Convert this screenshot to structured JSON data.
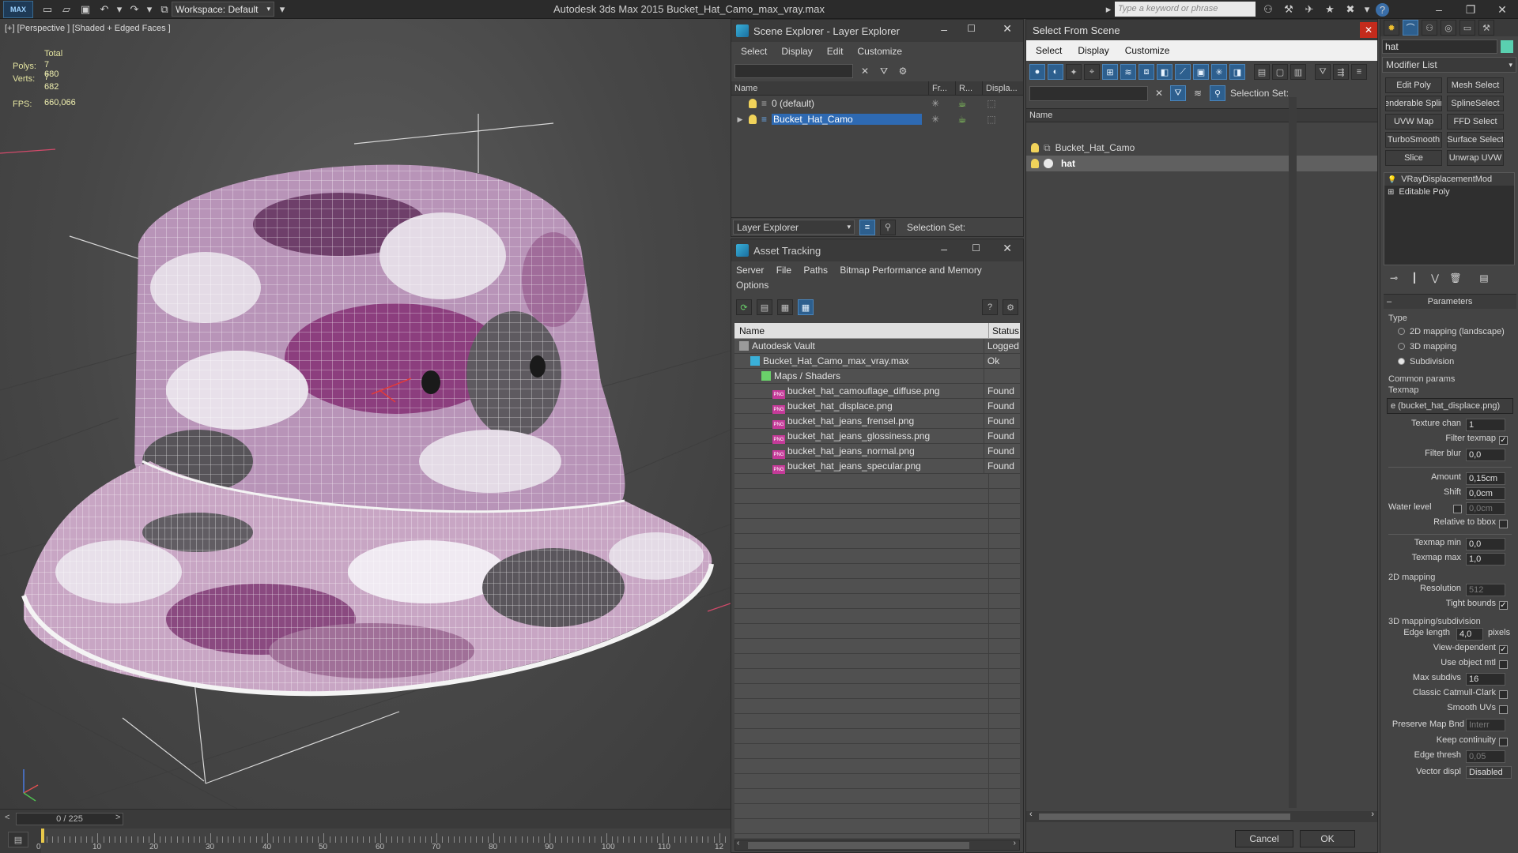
{
  "titlebar": {
    "logo": "MAX",
    "workspace": "Workspace: Default",
    "app_title": "Autodesk 3ds Max  2015      Bucket_Hat_Camo_max_vray.max",
    "search_placeholder": "Type a keyword or phrase"
  },
  "viewport": {
    "label": "[+] [Perspective ] [Shaded + Edged Faces ]",
    "stats": {
      "total_label": "Total",
      "polys_label": "Polys:",
      "polys": "7 680",
      "verts_label": "Verts:",
      "verts": "7 682",
      "fps_label": "FPS:",
      "fps": "660,066"
    }
  },
  "timeline": {
    "slider": "0 / 225",
    "ticks": [
      "0",
      "10",
      "20",
      "30",
      "40",
      "50",
      "60",
      "70",
      "80",
      "90",
      "100",
      "110",
      "12"
    ]
  },
  "scene_explorer": {
    "title": "Scene Explorer - Layer Explorer",
    "menu": [
      "Select",
      "Display",
      "Edit",
      "Customize"
    ],
    "columns": [
      "Name",
      "Fr...",
      "R...",
      "Displa..."
    ],
    "layers": [
      {
        "name": "0 (default)",
        "selected": false
      },
      {
        "name": "Bucket_Hat_Camo",
        "selected": true
      }
    ],
    "footer_dropdown": "Layer Explorer",
    "selection_set_label": "Selection Set:"
  },
  "asset_tracking": {
    "title": "Asset Tracking",
    "menu": [
      "Server",
      "File",
      "Paths",
      "Bitmap Performance and Memory",
      "Options"
    ],
    "columns": {
      "name": "Name",
      "status": "Status"
    },
    "rows": [
      {
        "name": "Autodesk Vault",
        "status": "Logged",
        "indent": 0,
        "icon": "vault-icon"
      },
      {
        "name": "Bucket_Hat_Camo_max_vray.max",
        "status": "Ok",
        "indent": 1,
        "icon": "max-file-icon"
      },
      {
        "name": "Maps / Shaders",
        "status": "",
        "indent": 2,
        "icon": "maps-folder-icon"
      },
      {
        "name": "bucket_hat_camouflage_diffuse.png",
        "status": "Found",
        "indent": 3,
        "icon": "png-icon"
      },
      {
        "name": "bucket_hat_displace.png",
        "status": "Found",
        "indent": 3,
        "icon": "png-icon"
      },
      {
        "name": "bucket_hat_jeans_frensel.png",
        "status": "Found",
        "indent": 3,
        "icon": "png-icon"
      },
      {
        "name": "bucket_hat_jeans_glossiness.png",
        "status": "Found",
        "indent": 3,
        "icon": "png-icon"
      },
      {
        "name": "bucket_hat_jeans_normal.png",
        "status": "Found",
        "indent": 3,
        "icon": "png-icon"
      },
      {
        "name": "bucket_hat_jeans_specular.png",
        "status": "Found",
        "indent": 3,
        "icon": "png-icon"
      }
    ],
    "png_badge": "PNG"
  },
  "select_from_scene": {
    "title": "Select From Scene",
    "menu": [
      "Select",
      "Display",
      "Customize"
    ],
    "selection_set_label": "Selection Set:",
    "column": "Name",
    "items": [
      {
        "name": "Bucket_Hat_Camo",
        "selected": false
      },
      {
        "name": "hat",
        "selected": true
      }
    ],
    "ok": "OK",
    "cancel": "Cancel"
  },
  "command_panel": {
    "object_name": "hat",
    "modifier_list": "Modifier List",
    "modifier_buttons": [
      "Edit Poly",
      "Mesh Select",
      "enderable Splir",
      "SplineSelect",
      "UVW Map",
      "FFD Select",
      "TurboSmooth",
      "Surface Select",
      "Slice",
      "Unwrap UVW"
    ],
    "stack": [
      "VRayDisplacementMod",
      "Editable Poly"
    ],
    "rollout": "Parameters",
    "type_label": "Type",
    "type_options": [
      {
        "label": "2D mapping (landscape)",
        "on": false
      },
      {
        "label": "3D mapping",
        "on": false
      },
      {
        "label": "Subdivision",
        "on": true
      }
    ],
    "common_params": "Common params",
    "texmap_label": "Texmap",
    "texmap_value": "e (bucket_hat_displace.png)",
    "texture_chan_label": "Texture chan",
    "texture_chan": "1",
    "filter_texmap": "Filter texmap",
    "filter_blur_label": "Filter blur",
    "filter_blur": "0,0",
    "amount_label": "Amount",
    "amount": "0,15cm",
    "shift_label": "Shift",
    "shift": "0,0cm",
    "water_level_label": "Water level",
    "water_level": "0,0cm",
    "relative_bbox": "Relative to bbox",
    "texmap_min_label": "Texmap min",
    "texmap_min": "0,0",
    "texmap_max_label": "Texmap max",
    "texmap_max": "1,0",
    "mapping_2d": "2D mapping",
    "resolution_label": "Resolution",
    "resolution": "512",
    "tight_bounds": "Tight bounds",
    "mapping_3d": "3D mapping/subdivision",
    "edge_length_label": "Edge length",
    "edge_length": "4,0",
    "pixels": "pixels",
    "view_dependent": "View-dependent",
    "use_object_mtl": "Use object mtl",
    "max_subdivs_label": "Max subdivs",
    "max_subdivs": "16",
    "classic_catmull": "Classic Catmull-Clark",
    "smooth_uvs": "Smooth UVs",
    "preserve_map_bnd": "Preserve Map Bnd",
    "preserve_map_value": "Interr",
    "keep_continuity": "Keep continuity",
    "edge_thresh_label": "Edge thresh",
    "edge_thresh": "0,05",
    "vector_displ_label": "Vector displ",
    "vector_displ": "Disabled"
  }
}
